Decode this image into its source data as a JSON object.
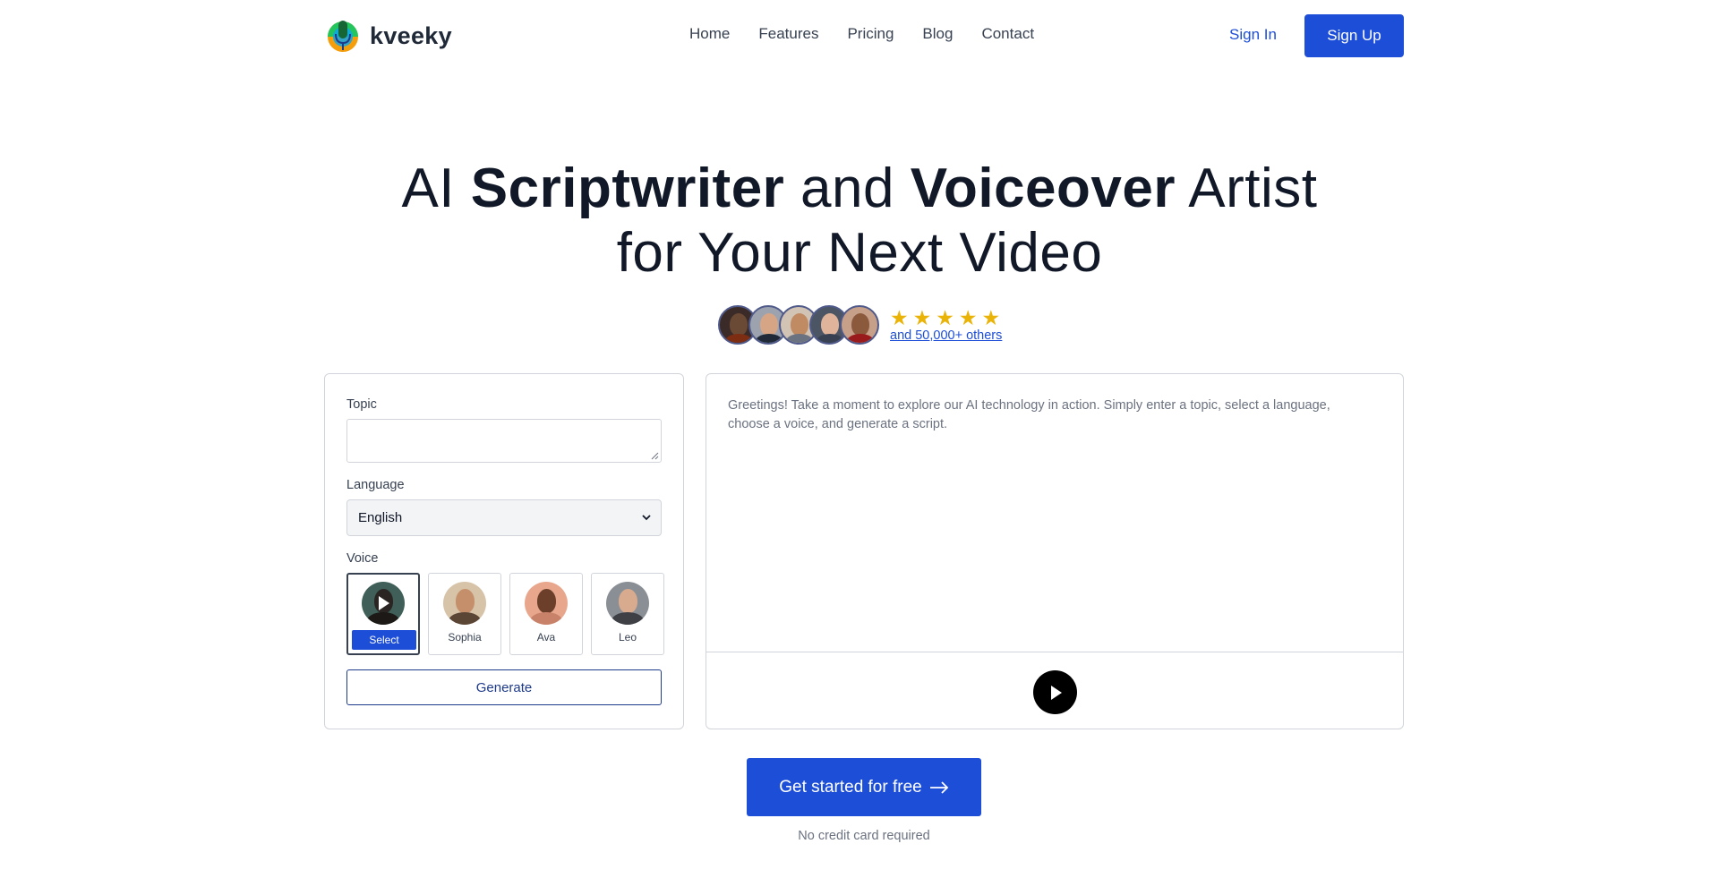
{
  "brand": {
    "name": "kveeky"
  },
  "nav": {
    "items": [
      {
        "label": "Home"
      },
      {
        "label": "Features"
      },
      {
        "label": "Pricing"
      },
      {
        "label": "Blog"
      },
      {
        "label": "Contact"
      }
    ],
    "sign_in": "Sign In",
    "sign_up": "Sign Up"
  },
  "hero": {
    "line1_a": "AI ",
    "line1_b": "Scriptwriter",
    "line1_c": " and ",
    "line1_d": "Voiceover",
    "line1_e": " Artist",
    "line2": "for Your Next Video"
  },
  "social_proof": {
    "rating_stars": 5,
    "others_link": "and 50,000+ others"
  },
  "form": {
    "topic_label": "Topic",
    "topic_value": "",
    "language_label": "Language",
    "language_selected": "English",
    "voice_label": "Voice",
    "voices": [
      {
        "name": "Select",
        "selected": true
      },
      {
        "name": "Sophia",
        "selected": false
      },
      {
        "name": "Ava",
        "selected": false
      },
      {
        "name": "Leo",
        "selected": false
      }
    ],
    "generate_label": "Generate"
  },
  "output": {
    "greeting": "Greetings! Take a moment to explore our AI technology in action. Simply enter a topic, select a language, choose a voice, and generate a script."
  },
  "cta": {
    "label": "Get started for free",
    "note": "No credit card required"
  },
  "colors": {
    "primary": "#1d4ed8",
    "star": "#eab308",
    "border": "#d1d5db",
    "text_dark": "#111827",
    "text_muted": "#6b7280"
  }
}
